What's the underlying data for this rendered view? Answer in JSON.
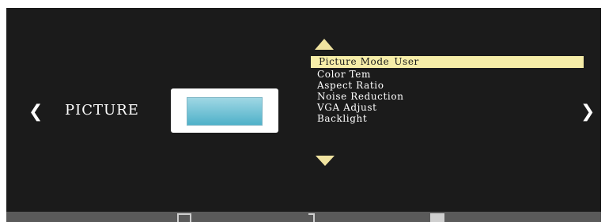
{
  "header": {
    "section_title": "PICTURE"
  },
  "nav": {
    "left_arrow": "❮",
    "right_arrow": "❯"
  },
  "menu": {
    "items": [
      {
        "label": "Picture Mode",
        "value": "User",
        "selected": true
      },
      {
        "label": "Color Tem",
        "value": ""
      },
      {
        "label": "Aspect Ratio",
        "value": ""
      },
      {
        "label": "Noise Reduction",
        "value": ""
      },
      {
        "label": "VGA  Adjust",
        "value": ""
      },
      {
        "label": "Backlight",
        "value": ""
      }
    ]
  },
  "tabs": [
    {
      "icon": "picture-tab-icon"
    },
    {
      "icon": "sound-tab-icon"
    },
    {
      "icon": "setup-tab-icon"
    }
  ],
  "colors": {
    "osd_background": "#1b1b1b",
    "highlight": "#f6eda8",
    "scroll_arrow": "#f0e3a0",
    "bottom_bar": "#5a5a5a"
  }
}
